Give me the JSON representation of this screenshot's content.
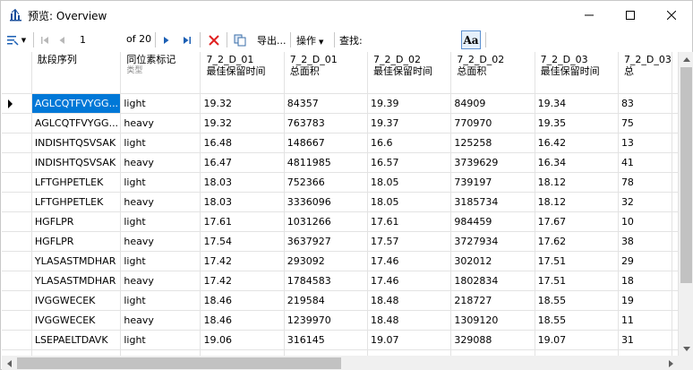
{
  "window": {
    "title": "预览: Overview"
  },
  "toolbar": {
    "position": "1",
    "of_label": "of 20",
    "export_label": "导出...",
    "operate_label": "操作",
    "find_label": "查找:",
    "font_button": "Aa"
  },
  "icons": {
    "app": "bar-chart-icon",
    "layout": "layout-icon",
    "first": "first-page-icon",
    "prev": "prev-page-icon",
    "next": "next-page-icon",
    "last": "last-page-icon",
    "delete": "delete-icon",
    "copy": "copy-icon",
    "font": "font-icon"
  },
  "grid": {
    "columns": [
      {
        "label": "肽段序列",
        "sub": ""
      },
      {
        "label": "同位素标记",
        "sub": "类型"
      },
      {
        "label": "7_2_D_01\n最佳保留时间",
        "sub": ""
      },
      {
        "label": "7_2_D_01\n总面积",
        "sub": ""
      },
      {
        "label": "7_2_D_02\n最佳保留时间",
        "sub": ""
      },
      {
        "label": "7_2_D_02\n总面积",
        "sub": ""
      },
      {
        "label": "7_2_D_03\n最佳保留时间",
        "sub": ""
      },
      {
        "label": "7_2_D_03\n总",
        "sub": ""
      }
    ],
    "rows": [
      [
        "AGLCQTFVYGG...",
        "light",
        "19.32",
        "84357",
        "19.39",
        "84909",
        "19.34",
        "83"
      ],
      [
        "AGLCQTFVYGG...",
        "heavy",
        "19.32",
        "763783",
        "19.37",
        "770970",
        "19.35",
        "75"
      ],
      [
        "INDISHTQSVSAK",
        "light",
        "16.48",
        "148667",
        "16.6",
        "125258",
        "16.42",
        "13"
      ],
      [
        "INDISHTQSVSAK",
        "heavy",
        "16.47",
        "4811985",
        "16.57",
        "3739629",
        "16.34",
        "41"
      ],
      [
        "LFTGHPETLEK",
        "light",
        "18.03",
        "752366",
        "18.05",
        "739197",
        "18.12",
        "78"
      ],
      [
        "LFTGHPETLEK",
        "heavy",
        "18.03",
        "3336096",
        "18.05",
        "3185734",
        "18.12",
        "32"
      ],
      [
        "HGFLPR",
        "light",
        "17.61",
        "1031266",
        "17.61",
        "984459",
        "17.67",
        "10"
      ],
      [
        "HGFLPR",
        "heavy",
        "17.54",
        "3637927",
        "17.57",
        "3727934",
        "17.62",
        "38"
      ],
      [
        "YLASASTMDHAR",
        "light",
        "17.42",
        "293092",
        "17.46",
        "302012",
        "17.51",
        "29"
      ],
      [
        "YLASASTMDHAR",
        "heavy",
        "17.42",
        "1784583",
        "17.46",
        "1802834",
        "17.51",
        "18"
      ],
      [
        "IVGGWECEK",
        "light",
        "18.46",
        "219584",
        "18.48",
        "218727",
        "18.55",
        "19"
      ],
      [
        "IVGGWECEK",
        "heavy",
        "18.46",
        "1239970",
        "18.48",
        "1309120",
        "18.55",
        "11"
      ],
      [
        "LSEPAELTDAVK",
        "light",
        "19.06",
        "316145",
        "19.07",
        "329088",
        "19.07",
        "31"
      ],
      [
        "",
        "",
        "",
        "",
        "",
        "",
        "",
        ""
      ]
    ]
  }
}
